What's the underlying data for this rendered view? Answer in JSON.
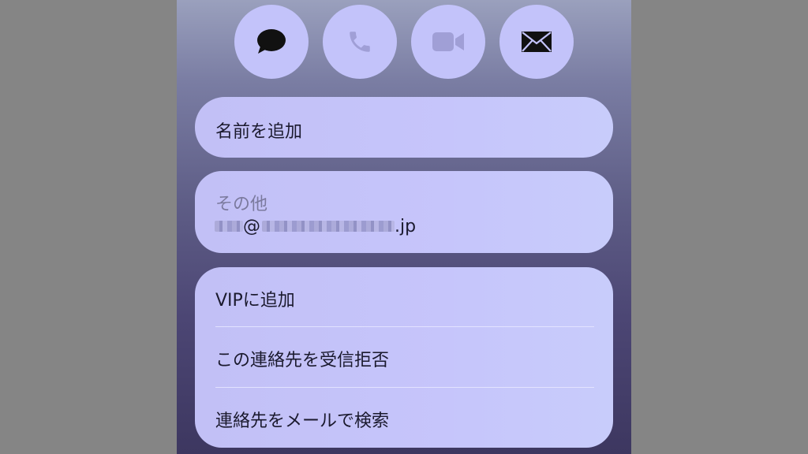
{
  "actions": [
    {
      "name": "message",
      "icon": "message-bubble-icon",
      "color": "#111111"
    },
    {
      "name": "phone",
      "icon": "phone-icon",
      "color": "#a09fd6"
    },
    {
      "name": "video",
      "icon": "video-camera-icon",
      "color": "#a09fd6"
    },
    {
      "name": "mail",
      "icon": "envelope-icon",
      "color": "#111111"
    }
  ],
  "name_card": {
    "label": "名前を追加"
  },
  "email_card": {
    "label": "その他",
    "at": "@",
    "suffix": ".jp"
  },
  "action_list": {
    "items": [
      {
        "label": "VIPに追加"
      },
      {
        "label": "この連絡先を受信拒否"
      },
      {
        "label": "連絡先をメールで検索"
      }
    ]
  }
}
